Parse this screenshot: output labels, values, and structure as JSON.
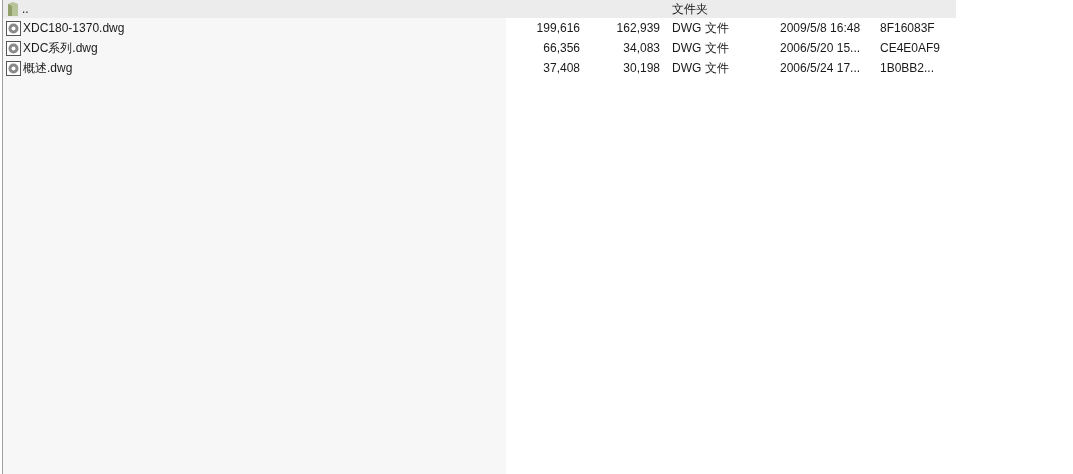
{
  "file_list": {
    "rows": [
      {
        "kind": "folder",
        "selected": true,
        "name": "..",
        "type": "文件夹"
      },
      {
        "kind": "file",
        "selected": false,
        "name": "XDC180-1370.dwg",
        "size": "199,616",
        "packed": "162,939",
        "type": "DWG 文件",
        "modified": "2009/5/8 16:48",
        "crc": "8F16083F"
      },
      {
        "kind": "file",
        "selected": false,
        "name": "XDC系列.dwg",
        "size": "66,356",
        "packed": "34,083",
        "type": "DWG 文件",
        "modified": "2006/5/20 15...",
        "crc": "CE4E0AF9"
      },
      {
        "kind": "file",
        "selected": false,
        "name": "概述.dwg",
        "size": "37,408",
        "packed": "30,198",
        "type": "DWG 文件",
        "modified": "2006/5/24 17...",
        "crc": "1B0BB2..."
      }
    ]
  }
}
